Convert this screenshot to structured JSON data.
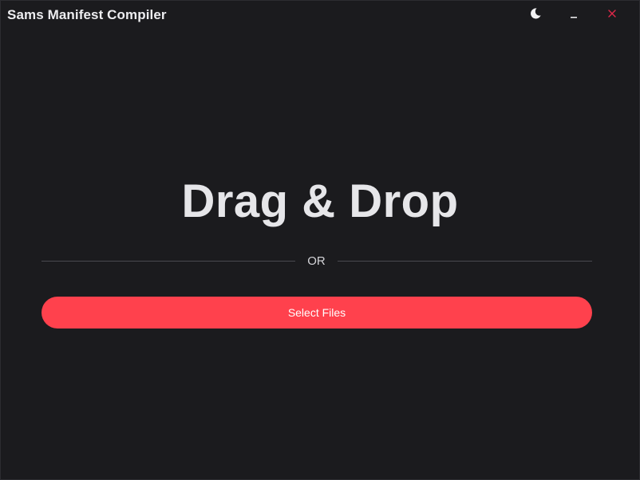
{
  "window": {
    "title": "Sams Manifest Compiler",
    "controls": {
      "theme_icon": "moon-icon",
      "minimize_icon": "minimize-icon",
      "close_icon": "close-icon"
    }
  },
  "main": {
    "heading": "Drag & Drop",
    "divider_text": "OR",
    "select_button_label": "Select Files"
  },
  "colors": {
    "background": "#1b1b1e",
    "accent": "#ff414d",
    "close_icon": "#e0284a",
    "text": "#e6e6e9"
  }
}
